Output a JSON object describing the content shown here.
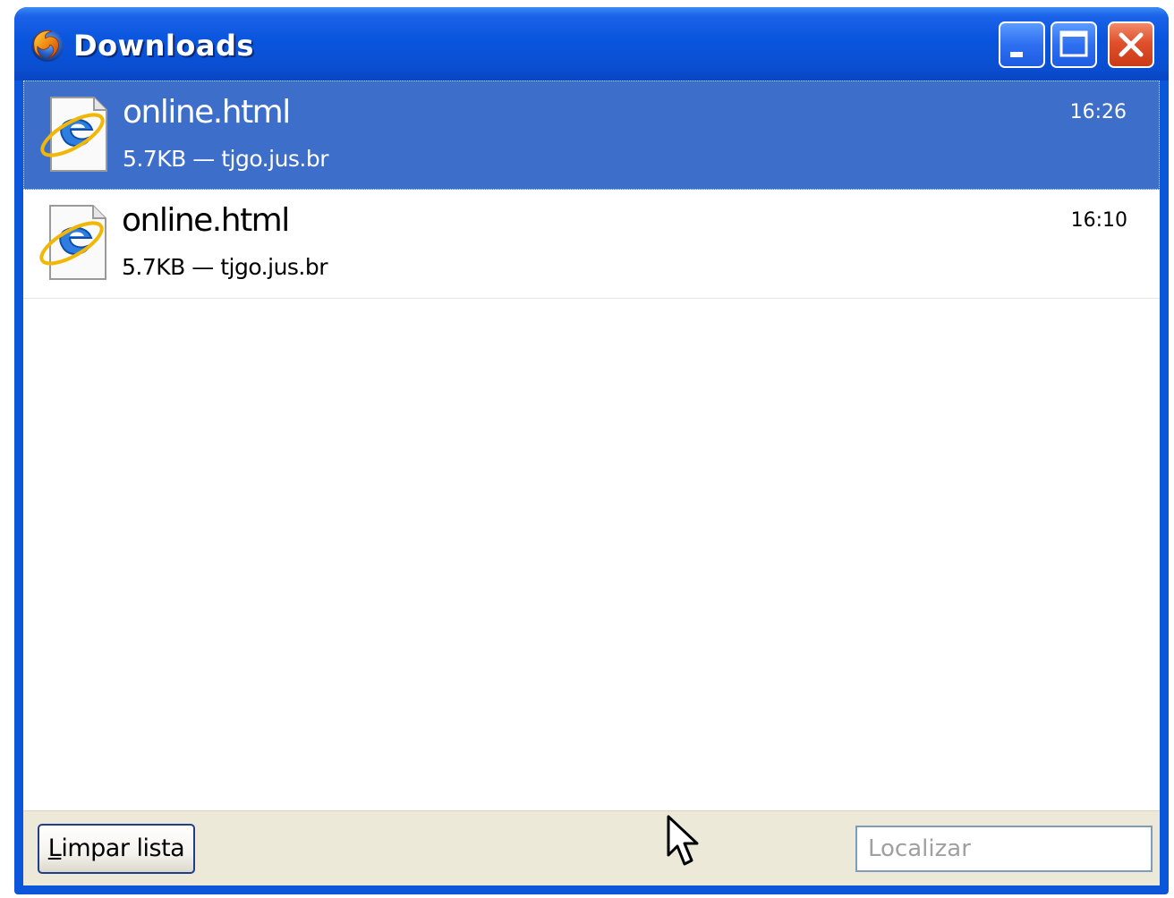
{
  "window": {
    "title": "Downloads",
    "icon": "firefox-icon",
    "controls": [
      "minimize-icon",
      "maximize-icon",
      "close-icon"
    ]
  },
  "downloads": [
    {
      "filename": "online.html",
      "details": "5.7KB — tjgo.jus.br",
      "time": "16:26",
      "selected": true,
      "icon": "internet-explorer-file-icon"
    },
    {
      "filename": "online.html",
      "details": "5.7KB — tjgo.jus.br",
      "time": "16:10",
      "selected": false,
      "icon": "internet-explorer-file-icon"
    }
  ],
  "footer": {
    "clear_button": {
      "accel": "L",
      "rest": "impar lista"
    },
    "search": {
      "placeholder": "Localizar",
      "value": ""
    }
  },
  "colors": {
    "titlebar": "#0a55de",
    "selection": "#3d6ec9",
    "footer": "#ece9d8",
    "close_button": "#e0502c"
  }
}
